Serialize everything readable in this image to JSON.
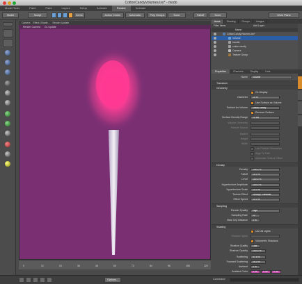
{
  "window": {
    "title": "CottonCandyVolumes.lxo* - modo"
  },
  "menus": [
    "Model Tools",
    "Paint",
    "Paint",
    "Layout",
    "Setup",
    "Animate",
    "Render",
    "Animate"
  ],
  "menu_active_index": 6,
  "toolbar": {
    "model": "Model",
    "sculpt": "Sculpt",
    "items": "Items",
    "action_center": "Action Center",
    "action_center_value": "Automatic",
    "snapping": "Snap",
    "poly_groups": "Poly Groups",
    "none": "None",
    "falloff": "Falloff",
    "falloff_value": "None",
    "workplane": "Work Plane"
  },
  "viewport": {
    "tabs": [
      "Camera",
      "Effect (Shade...",
      "Render Update"
    ],
    "sub_tabs": [
      "Render Camera",
      "GL Update"
    ]
  },
  "timeline": {
    "ticks": [
      "0",
      "12",
      "24",
      "36",
      "48",
      "60",
      "72",
      "84",
      "96",
      "108",
      "120"
    ]
  },
  "bottom": {
    "options": "Options...",
    "command": "Command"
  },
  "right_panel": {
    "top_tabs": [
      "Items",
      "Shading",
      "Groups",
      "Images"
    ],
    "filter_label": "Filter Items",
    "add_layer": "Add Layer",
    "tree_header": "Name",
    "tree": [
      {
        "label": "CottonCandyVolumes.lxo*",
        "indent": 0,
        "color": "#5a7fb0",
        "selected": false
      },
      {
        "label": "Volume",
        "indent": 1,
        "color": "#6aa0d8",
        "selected": true
      },
      {
        "label": "handle",
        "indent": 1,
        "color": "#a0a0a0",
        "selected": false
      },
      {
        "label": "cotton candy",
        "indent": 1,
        "color": "#a0a0a0",
        "selected": false
      },
      {
        "label": "Camera",
        "indent": 1,
        "color": "#c0c0c0",
        "selected": false
      },
      {
        "label": "Texture Group",
        "indent": 1,
        "color": "#a07840",
        "selected": false
      }
    ],
    "prop_tabs": [
      "Properties",
      "Channels",
      "Display",
      "Lists"
    ],
    "name_label": "Name",
    "name_value": "Volume",
    "transform": "Transform",
    "geometry": "Geometry",
    "gl_display": "GL Display",
    "diameter_label": "Diameter",
    "diameter_value": "10 m",
    "use_surface": "Use Surface as Volume",
    "surface_as_volume_label": "Surface As Volume",
    "surface_as_volume_value": "cotton candy",
    "remove_surface": "Remove Surface",
    "surface_density_label": "Surface Density Range",
    "surface_density_value": "10 cm",
    "volume_geometry_label": "Volume Geometry",
    "particle_source_label": "Particle Source",
    "radius_label": "Radius",
    "height_label": "Height",
    "width_label": "Width",
    "use_particle": "Use Particle Orientation",
    "align_to_path": "Align To Path",
    "auto_texture": "Automatic Texture Offset",
    "density": "Density",
    "density_label": "Density",
    "density_value": "145.0 %",
    "falloff_label": "Falloff",
    "falloff_value": "10.0 %",
    "level_label": "Level",
    "level_value": "100.0 %",
    "hyper_amp_label": "Hypertexture Amplitude",
    "hyper_amp_value": "100.0 %",
    "hyper_scale_label": "Hypertexture Scale",
    "hyper_scale_value": "10.0 %",
    "texture_effect_label": "Texture Effect",
    "texture_effect_value": "Velocity Translate",
    "effect_speed_label": "Effect Speed",
    "effect_speed_value": "10.0 %",
    "sampling": "Sampling",
    "render_quality_label": "Render Quality",
    "render_quality_value": "High",
    "sampling_rate_label": "Sampling Rate",
    "sampling_rate_value": "12",
    "near_clip_label": "Near Clip Distance",
    "near_clip_value": "0 m",
    "shading": "Shading",
    "use_all_lights": "Use All Lights",
    "shadow_lights_label": "Shadow Lights",
    "volumetric_shadows": "Volumetric Shadows",
    "shadow_quality_label": "Shadow Quality",
    "shadow_quality_value": "Low",
    "shadow_opacity_label": "Shadow Opacity",
    "shadow_opacity_value": "100.0 %",
    "scattering_label": "Scattering",
    "scattering_value": "97.5 %",
    "forward_label": "Forward Scattering",
    "forward_value": "25.0 %",
    "ambient_label": "Ambient",
    "ambient_value": "0 %",
    "ambient_color_label": "Ambient Color",
    "ambient_color_values": [
      "0.45",
      "0.45",
      "0.45"
    ],
    "side_tabs": [
      "Shading",
      "Fur",
      "Mesh Items",
      "Surface"
    ]
  },
  "colors": {
    "viewport_bg": "#7b2f73",
    "accent": "#d88b2a",
    "selection": "#2c5ea8",
    "cotton": "#ff2f8c"
  }
}
